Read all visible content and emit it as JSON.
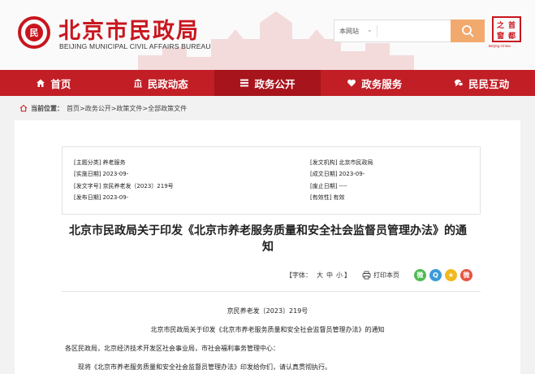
{
  "header": {
    "title": "北京市民政局",
    "subtitle": "BEIJING MUNICIPAL CIVIL AFFAIRS BUREAU",
    "logo_glyph": "民",
    "search": {
      "scope": "本网站",
      "placeholder": ""
    },
    "capital_logo": {
      "chars": [
        "之",
        "首",
        "窗",
        "都"
      ],
      "caption": "Beijing·China"
    }
  },
  "nav": {
    "items": [
      {
        "label": "首页",
        "icon": "home-icon"
      },
      {
        "label": "民政动态",
        "icon": "building-icon"
      },
      {
        "label": "政务公开",
        "icon": "list-icon",
        "active": true
      },
      {
        "label": "政务服务",
        "icon": "heart-icon"
      },
      {
        "label": "民民互动",
        "icon": "chat-icon"
      }
    ]
  },
  "breadcrumb": {
    "label": "当前位置：",
    "path": "首页>政务公开>政策文件>全部政策文件"
  },
  "meta": {
    "left": [
      {
        "key": "[主题分类]",
        "value": "养老服务"
      },
      {
        "key": "[实施日期]",
        "value": "2023-09-"
      },
      {
        "key": "[发文字号]",
        "value": "京民养老发〔2023〕219号"
      },
      {
        "key": "[发布日期]",
        "value": "2023-09-"
      }
    ],
    "right": [
      {
        "key": "[发文机构]",
        "value": "北京市民政局"
      },
      {
        "key": "[成文日期]",
        "value": "2023-09-"
      },
      {
        "key": "[废止日期]",
        "value": "----"
      },
      {
        "key": "[有效性]",
        "value": "有效"
      }
    ]
  },
  "document": {
    "title_line1": "北京市民政局关于印发《北京市养老服务质量和安全社会监督员管理办法》的通",
    "title_line2": "知",
    "tools": {
      "font_label": "【字体：",
      "font_large": "大",
      "font_medium": "中",
      "font_small": "小",
      "font_close": "】",
      "print_label": "打印本页"
    },
    "share": [
      {
        "icon": "wechat-icon",
        "color": "#4cbb4f",
        "glyph": "微"
      },
      {
        "icon": "qq-icon",
        "color": "#3a9ad9",
        "glyph": "Q"
      },
      {
        "icon": "qzone-icon",
        "color": "#f2b81e",
        "glyph": "★"
      },
      {
        "icon": "weibo-icon",
        "color": "#e8523f",
        "glyph": "微"
      }
    ],
    "doc_number": "京民养老发〔2023〕219号",
    "heading": "北京市民政局关于印发《北京市养老服务质量和安全社会监督员管理办法》的通知",
    "salutation": "各区民政局，北京经济技术开发区社会事业局，市社会福利事务管理中心：",
    "paragraph1": "现将《北京市养老服务质量和安全社会监督员管理办法》印发给你们，请认真贯彻执行。"
  }
}
